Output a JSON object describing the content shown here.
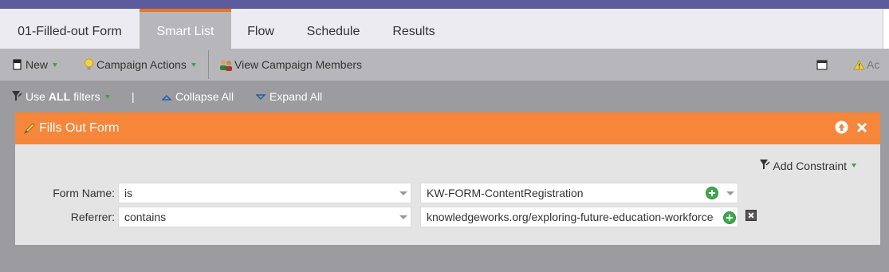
{
  "tabs": [
    {
      "label": "01-Filled-out Form"
    },
    {
      "label": "Smart List"
    },
    {
      "label": "Flow"
    },
    {
      "label": "Schedule"
    },
    {
      "label": "Results"
    }
  ],
  "active_tab": "Smart List",
  "toolbar": {
    "new_label": "New",
    "campaign_actions_label": "Campaign Actions",
    "view_members_label": "View Campaign Members",
    "activate_label": "Ac"
  },
  "filterbar": {
    "use_prefix": "Use",
    "use_all": "ALL",
    "use_suffix": "filters",
    "separator": "|",
    "collapse_label": "Collapse All",
    "expand_label": "Expand All"
  },
  "filter": {
    "title": "Fills Out Form",
    "add_constraint_label": "Add Constraint",
    "rows": [
      {
        "label": "Form Name:",
        "operator": "is",
        "value": "KW-FORM-ContentRegistration"
      },
      {
        "label": "Referrer:",
        "operator": "contains",
        "value": "knowledgeworks.org/exploring-future-education-workforce"
      }
    ]
  },
  "colors": {
    "topbar": "#5c5b9d",
    "tab_accent": "#e8772a",
    "filter_header": "#f6863a",
    "add_green": "#3daa4a"
  },
  "icons": [
    "new-doc-icon",
    "lightbulb-icon",
    "people-icon",
    "window-icon",
    "warning-icon",
    "filter-funnel-icon",
    "collapse-icon",
    "expand-icon",
    "pencil-icon",
    "move-up-icon",
    "close-icon",
    "plus-icon",
    "delete-icon"
  ]
}
